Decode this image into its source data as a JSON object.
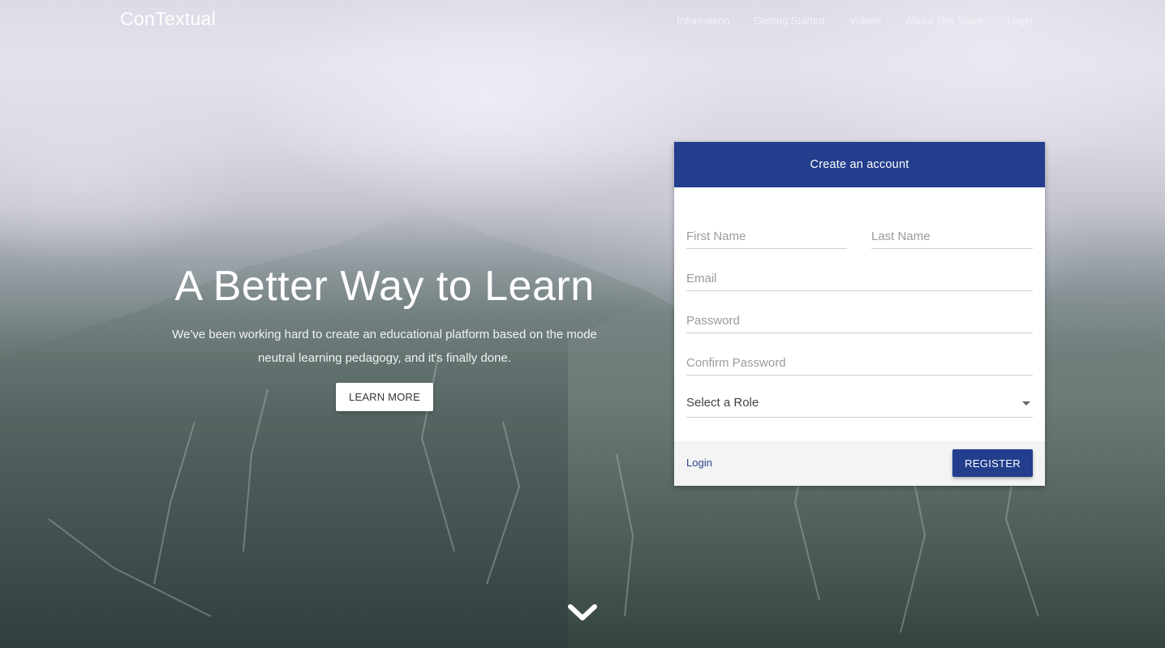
{
  "nav": {
    "brand": "ConTextual",
    "links": [
      "Information",
      "Getting Started",
      "Videos",
      "About The Team",
      "Login"
    ]
  },
  "hero": {
    "title": "A Better Way to Learn",
    "subtitle_line1": "We've been working hard to create an educational platform based on the mode",
    "subtitle_line2": "neutral learning pedagogy, and it's finally done.",
    "button": "LEARN MORE",
    "scroll_icon": "chevron-down-icon"
  },
  "form": {
    "header": "Create an account",
    "first_name_placeholder": "First Name",
    "last_name_placeholder": "Last Name",
    "email_placeholder": "Email",
    "password_placeholder": "Password",
    "confirm_password_placeholder": "Confirm Password",
    "role_value": "Select a Role",
    "login_link": "Login",
    "register_button": "REGISTER"
  },
  "colors": {
    "primary": "#223e8c",
    "white": "#ffffff"
  }
}
